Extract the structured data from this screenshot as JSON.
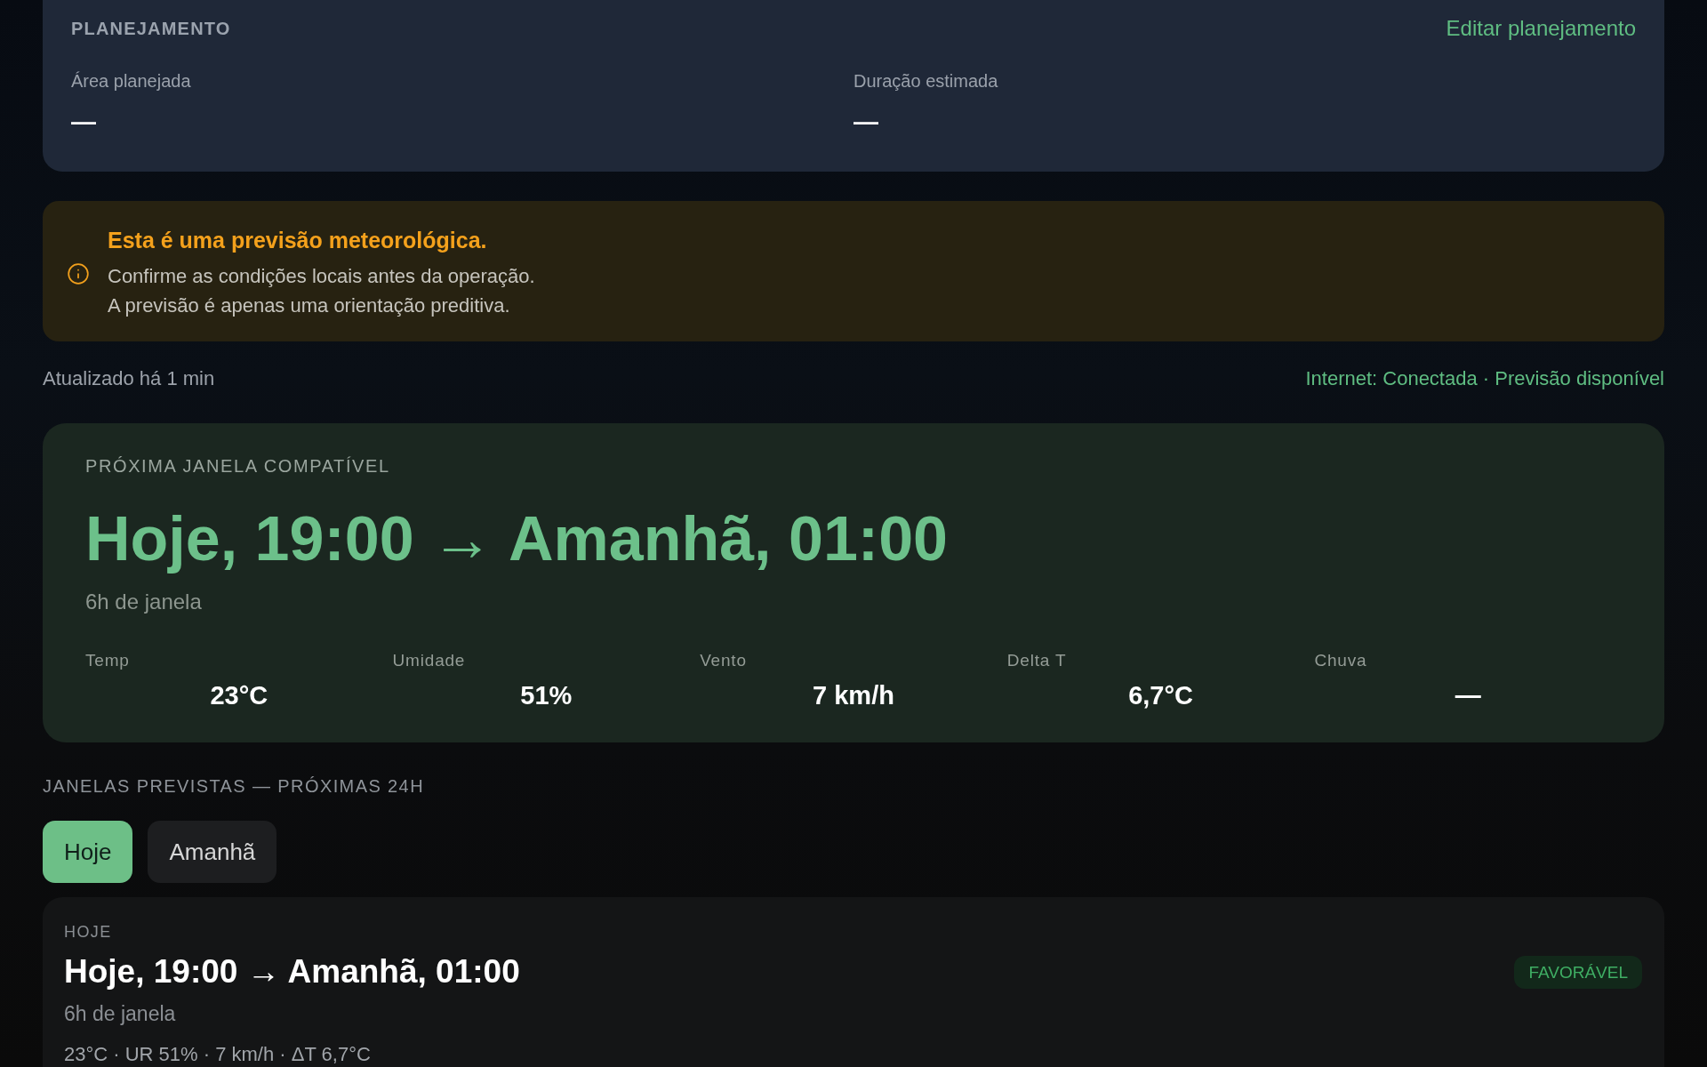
{
  "planning": {
    "title": "PLANEJAMENTO",
    "edit_link": "Editar planejamento",
    "fields": [
      {
        "label": "Área planejada",
        "value": "—"
      },
      {
        "label": "Duração estimada",
        "value": "—"
      }
    ]
  },
  "notice": {
    "title": "Esta é uma previsão meteorológica.",
    "lines": [
      "Confirme as condições locais antes da operação.",
      "A previsão é apenas uma orientação preditiva."
    ]
  },
  "status": {
    "updated": "Atualizado há 1 min",
    "connection": "Internet: Conectada · Previsão disponível"
  },
  "next_window": {
    "heading": "PRÓXIMA JANELA COMPATÍVEL",
    "range": "Hoje, 19:00 → Amanhã, 01:00",
    "duration": "6h de janela",
    "metrics": [
      {
        "label": "Temp",
        "value": "23°C"
      },
      {
        "label": "Umidade",
        "value": "51%"
      },
      {
        "label": "Vento",
        "value": "7 km/h"
      },
      {
        "label": "Delta T",
        "value": "6,7°C"
      },
      {
        "label": "Chuva",
        "value": "—"
      }
    ]
  },
  "forecast": {
    "heading": "JANELAS PREVISTAS — PRÓXIMAS 24H",
    "tabs": [
      {
        "label": "Hoje",
        "selected": true
      },
      {
        "label": "Amanhã",
        "selected": false
      }
    ],
    "windows": [
      {
        "day": "HOJE",
        "range": "Hoje, 19:00 → Amanhã, 01:00",
        "duration": "6h de janela",
        "summary": "23°C · UR 51% · 7 km/h · ΔT 6,7°C",
        "status": "FAVORÁVEL"
      }
    ]
  }
}
